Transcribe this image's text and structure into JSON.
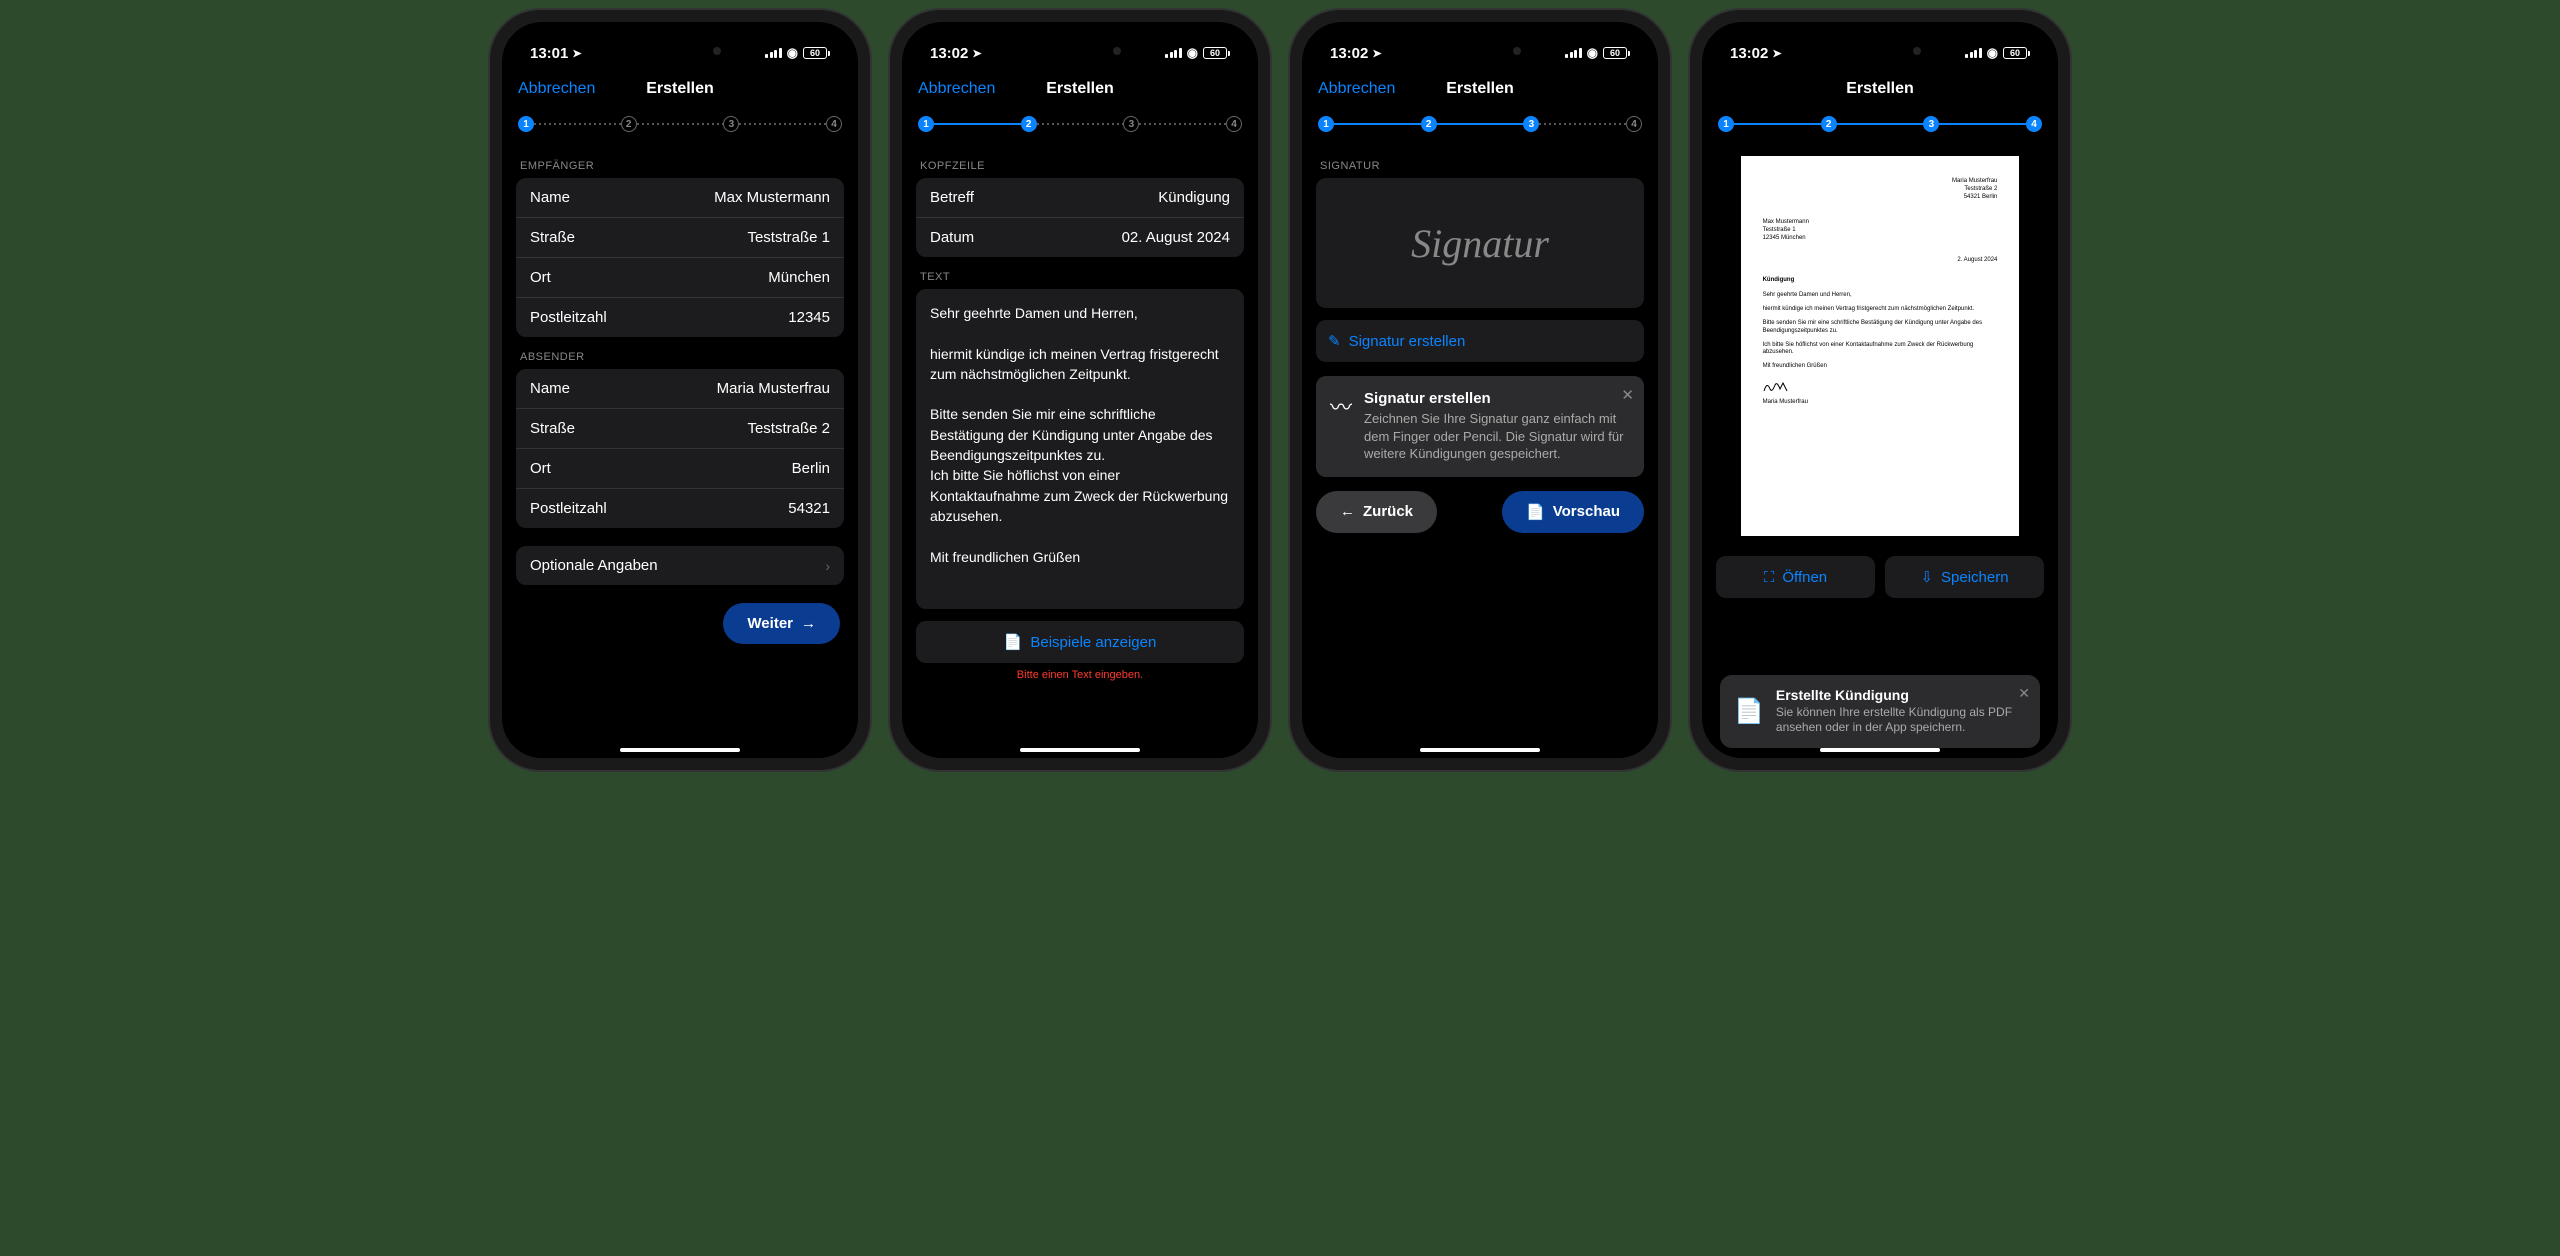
{
  "status": {
    "time1": "13:01",
    "time2": "13:02",
    "battery": "60"
  },
  "nav": {
    "cancel": "Abbrechen",
    "title": "Erstellen"
  },
  "steps": [
    "1",
    "2",
    "3",
    "4"
  ],
  "s1": {
    "recipient_header": "EMPFÄNGER",
    "recipient": {
      "name_l": "Name",
      "name_v": "Max Mustermann",
      "street_l": "Straße",
      "street_v": "Teststraße 1",
      "city_l": "Ort",
      "city_v": "München",
      "zip_l": "Postleitzahl",
      "zip_v": "12345"
    },
    "sender_header": "ABSENDER",
    "sender": {
      "name_l": "Name",
      "name_v": "Maria Musterfrau",
      "street_l": "Straße",
      "street_v": "Teststraße 2",
      "city_l": "Ort",
      "city_v": "Berlin",
      "zip_l": "Postleitzahl",
      "zip_v": "54321"
    },
    "optional": "Optionale Angaben",
    "next": "Weiter"
  },
  "s2": {
    "header_section": "KOPFZEILE",
    "subject_l": "Betreff",
    "subject_v": "Kündigung",
    "date_l": "Datum",
    "date_v": "02. August 2024",
    "text_section": "TEXT",
    "body": "Sehr geehrte Damen und Herren,\n\nhiermit kündige ich meinen Vertrag fristgerecht zum nächstmöglichen Zeitpunkt.\n\nBitte senden Sie mir eine schriftliche Bestätigung der Kündigung unter Angabe des Beendigungszeitpunktes zu.\nIch bitte Sie höflichst von einer Kontaktaufnahme zum Zweck der Rückwerbung abzusehen.\n\nMit freundlichen Grüßen",
    "examples": "Beispiele anzeigen",
    "error": "Bitte einen Text eingeben."
  },
  "s3": {
    "sig_header": "SIGNATUR",
    "sig_placeholder": "Signatur",
    "create_sig": "Signatur erstellen",
    "tip_title": "Signatur erstellen",
    "tip_body": "Zeichnen Sie Ihre Signatur ganz einfach mit dem Finger oder Pencil. Die Signatur wird für weitere Kündigungen gespeichert.",
    "back": "Zurück",
    "preview": "Vorschau"
  },
  "s4": {
    "doc": {
      "sender_name": "Maria Musterfrau",
      "sender_street": "Teststraße 2",
      "sender_cityline": "54321 Berlin",
      "recip_name": "Max Mustermann",
      "recip_street": "Teststraße 1",
      "recip_cityline": "12345 München",
      "date": "2. August 2024",
      "subject": "Kündigung",
      "p1": "Sehr geehrte Damen und Herren,",
      "p2": "hiermit kündige ich meinen Vertrag fristgerecht zum nächstmöglichen Zeitpunkt.",
      "p3": "Bitte senden Sie mir eine schriftliche Bestätigung der Kündigung unter Angabe des Beendigungszeitpunktes zu.",
      "p4": "Ich bitte Sie höflichst von einer Kontaktaufnahme zum Zweck der Rückwerbung abzusehen.",
      "p5": "Mit freundlichen Grüßen",
      "sig_name": "Maria Musterfrau"
    },
    "open": "Öffnen",
    "save": "Speichern",
    "toast_title": "Erstellte Kündigung",
    "toast_body": "Sie können Ihre erstellte Kündigung als PDF ansehen oder in der App speichern."
  }
}
